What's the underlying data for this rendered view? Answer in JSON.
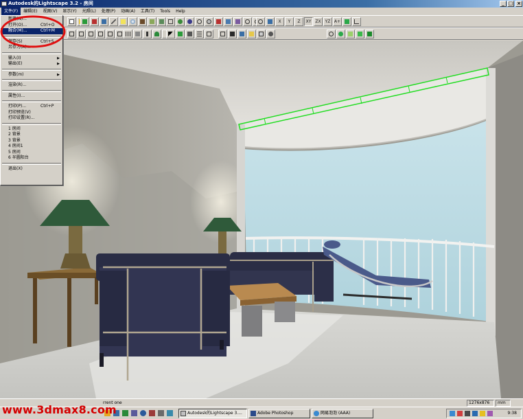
{
  "window": {
    "title": "Autodesk的Lightscape 3.2 - 房间",
    "min_label": "_",
    "max_label": "□",
    "close_label": "×"
  },
  "menubar": [
    "文件(F)",
    "编辑(E)",
    "视图(V)",
    "显示(Y)",
    "光照(L)",
    "处理(P)",
    "动画(A)",
    "工具(T)",
    "Tools",
    "Help"
  ],
  "file_menu": {
    "items": [
      {
        "label": "新建(N)...",
        "shortcut": ""
      },
      {
        "label": "打开(O)...",
        "shortcut": "Ctrl+O"
      },
      {
        "label": "融合(M)...",
        "shortcut": "Ctrl+M"
      },
      {
        "label": "保存(S)",
        "shortcut": "Ctrl+S"
      },
      {
        "label": "另存为(A)...",
        "shortcut": ""
      },
      {
        "label": "输入(I)",
        "shortcut": ""
      },
      {
        "label": "输出(E)",
        "shortcut": ""
      },
      {
        "label": "参数(m)",
        "shortcut": ""
      },
      {
        "label": "渲染(R)...",
        "shortcut": ""
      },
      {
        "label": "属性(I)...",
        "shortcut": ""
      },
      {
        "label": "打印(P)...",
        "shortcut": "Ctrl+P"
      },
      {
        "label": "打印预览(V)",
        "shortcut": ""
      },
      {
        "label": "打印设置(R)...",
        "shortcut": ""
      },
      {
        "label": "1 房间",
        "shortcut": ""
      },
      {
        "label": "2 背景",
        "shortcut": ""
      },
      {
        "label": "3 背景",
        "shortcut": ""
      },
      {
        "label": "4 房间1",
        "shortcut": ""
      },
      {
        "label": "5 房间",
        "shortcut": ""
      },
      {
        "label": "6 半圆阳台",
        "shortcut": ""
      },
      {
        "label": "退出(X)",
        "shortcut": ""
      }
    ],
    "highlighted_item": "融合(M)..."
  },
  "toolbar": {
    "view_buttons": [
      "X",
      "Y",
      "Z",
      "XY",
      "ZX",
      "YZ",
      "A+"
    ]
  },
  "status": {
    "text": "rrent one",
    "resolution": "1276x876",
    "unit": "mm"
  },
  "taskbar": {
    "tasks": [
      {
        "label": "Autodesk的Lightscape 3....",
        "active": true
      },
      {
        "label": "Adobe Photoshop",
        "active": false
      },
      {
        "label": "网易泡泡 (AAA)",
        "active": false
      }
    ],
    "clock": "9:38"
  },
  "watermark": "www.3dmax8.com",
  "colors": {
    "titlebar": "#0a246a",
    "selection_outline": "#22dd22",
    "annotation": "#e01010",
    "watermark": "#d40000"
  }
}
